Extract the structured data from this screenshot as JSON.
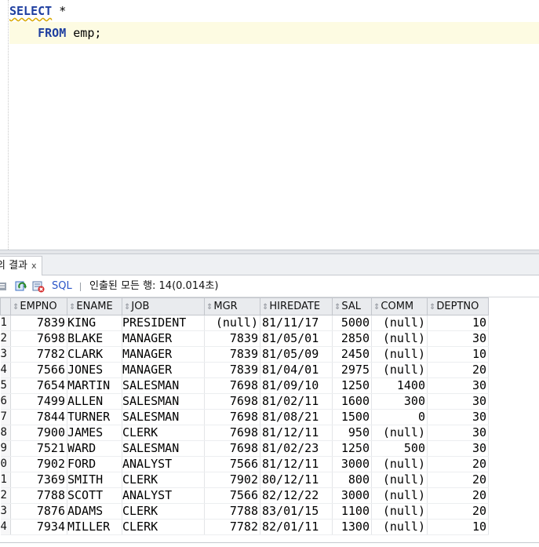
{
  "editor": {
    "line1_keyword": "SELECT",
    "line1_rest": " *",
    "line2_indent": "    ",
    "line2_keyword": "FROM",
    "line2_rest": " emp;"
  },
  "results_tab": {
    "label": "의 결과",
    "close_glyph": "x"
  },
  "toolbar": {
    "sql_label": "SQL",
    "status": "인출된 모든 행: 14(0.014초)"
  },
  "grid": {
    "columns": [
      "EMPNO",
      "ENAME",
      "JOB",
      "MGR",
      "HIREDATE",
      "SAL",
      "COMM",
      "DEPTNO"
    ],
    "rows": [
      [
        "1",
        "7839",
        "KING",
        "PRESIDENT",
        "(null)",
        "81/11/17",
        "5000",
        "(null)",
        "10"
      ],
      [
        "2",
        "7698",
        "BLAKE",
        "MANAGER",
        "7839",
        "81/05/01",
        "2850",
        "(null)",
        "30"
      ],
      [
        "3",
        "7782",
        "CLARK",
        "MANAGER",
        "7839",
        "81/05/09",
        "2450",
        "(null)",
        "10"
      ],
      [
        "4",
        "7566",
        "JONES",
        "MANAGER",
        "7839",
        "81/04/01",
        "2975",
        "(null)",
        "20"
      ],
      [
        "5",
        "7654",
        "MARTIN",
        "SALESMAN",
        "7698",
        "81/09/10",
        "1250",
        "1400",
        "30"
      ],
      [
        "6",
        "7499",
        "ALLEN",
        "SALESMAN",
        "7698",
        "81/02/11",
        "1600",
        "300",
        "30"
      ],
      [
        "7",
        "7844",
        "TURNER",
        "SALESMAN",
        "7698",
        "81/08/21",
        "1500",
        "0",
        "30"
      ],
      [
        "8",
        "7900",
        "JAMES",
        "CLERK",
        "7698",
        "81/12/11",
        "950",
        "(null)",
        "30"
      ],
      [
        "9",
        "7521",
        "WARD",
        "SALESMAN",
        "7698",
        "81/02/23",
        "1250",
        "500",
        "30"
      ],
      [
        "0",
        "7902",
        "FORD",
        "ANALYST",
        "7566",
        "81/12/11",
        "3000",
        "(null)",
        "20"
      ],
      [
        "1",
        "7369",
        "SMITH",
        "CLERK",
        "7902",
        "80/12/11",
        "800",
        "(null)",
        "20"
      ],
      [
        "2",
        "7788",
        "SCOTT",
        "ANALYST",
        "7566",
        "82/12/22",
        "3000",
        "(null)",
        "20"
      ],
      [
        "3",
        "7876",
        "ADAMS",
        "CLERK",
        "7788",
        "83/01/15",
        "1100",
        "(null)",
        "20"
      ],
      [
        "4",
        "7934",
        "MILLER",
        "CLERK",
        "7782",
        "82/01/11",
        "1300",
        "(null)",
        "10"
      ]
    ]
  },
  "icons": {
    "pin": "pin-icon",
    "refresh": "refresh-icon",
    "clear": "clear-icon",
    "sort": "sort-icon"
  }
}
